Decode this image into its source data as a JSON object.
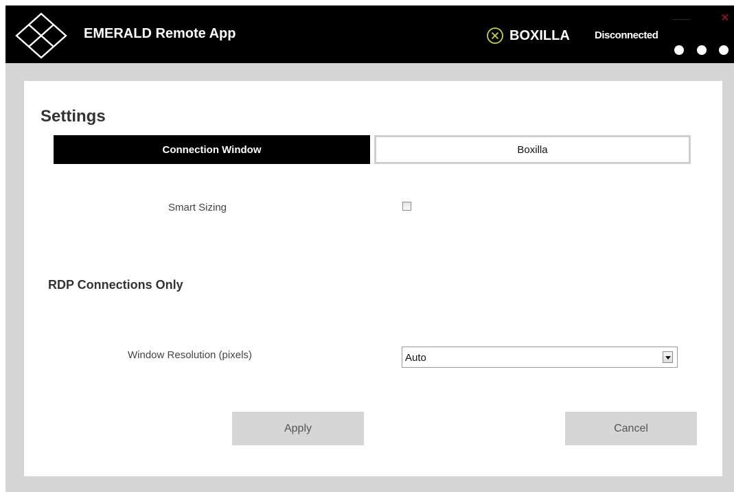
{
  "titlebar": {
    "app_title": "EMERALD Remote App",
    "boxilla_label": "BOXILLA",
    "boxilla_icon": "circle-x-icon",
    "connection_status": "Disconnected",
    "window_controls": [
      "minimize-icon",
      "close-icon"
    ],
    "more_menu_icon": "three-dots-icon"
  },
  "settings": {
    "title": "Settings",
    "tabs": [
      {
        "label": "Connection Window",
        "active": true
      },
      {
        "label": "Boxilla",
        "active": false
      }
    ],
    "smart_sizing": {
      "label": "Smart Sizing",
      "checked": false
    },
    "rdp_heading": "RDP Connections Only",
    "window_resolution": {
      "label": "Window Resolution (pixels)",
      "value": "Auto"
    },
    "buttons": {
      "apply": "Apply",
      "cancel": "Cancel"
    }
  },
  "colors": {
    "titlebar_bg": "#000000",
    "boxilla_icon": "#c9d62e",
    "close_icon": "#a8162e",
    "button_bg": "#d6d6d6",
    "app_bg": "#d5d5d5"
  }
}
